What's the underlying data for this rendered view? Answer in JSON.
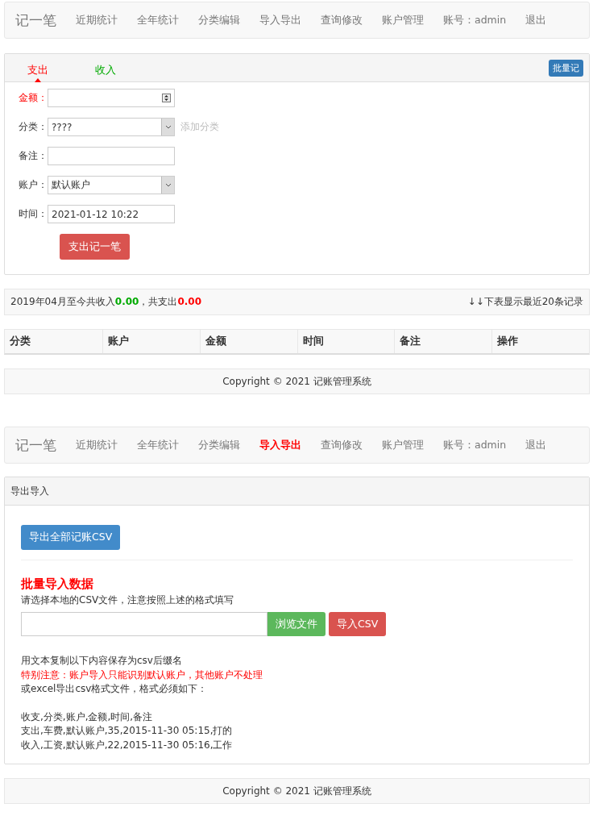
{
  "entry_screen": {
    "nav": {
      "brand": "记一笔",
      "items": [
        {
          "label": "近期统计",
          "selected": false
        },
        {
          "label": "全年统计",
          "selected": false
        },
        {
          "label": "分类编辑",
          "selected": false
        },
        {
          "label": "导入导出",
          "selected": false
        },
        {
          "label": "查询修改",
          "selected": false
        },
        {
          "label": "账户管理",
          "selected": false
        },
        {
          "label": "账号：admin",
          "selected": false
        },
        {
          "label": "退出",
          "selected": false
        }
      ]
    },
    "tabs": [
      {
        "label": "支出",
        "selected": true,
        "kind": "expense"
      },
      {
        "label": "收入",
        "selected": false,
        "kind": "income"
      }
    ],
    "batch_button": "批量记",
    "fields": [
      {
        "kind": "number",
        "label": "金额：",
        "required": true
      },
      {
        "kind": "select",
        "label": "分类：",
        "required": false,
        "value": "????",
        "link": "添加分类"
      },
      {
        "kind": "text",
        "label": "备注：",
        "required": false
      },
      {
        "kind": "select",
        "label": "账户：",
        "required": false,
        "value": "默认账户"
      },
      {
        "kind": "text",
        "label": "时间：",
        "required": false,
        "value": "2021-01-12 10:22"
      }
    ],
    "submit_button": "支出记一笔",
    "summary": {
      "prefix": "2019年04月至今共收入",
      "income": "0.00",
      "middle": "，共支出",
      "expense": "0.00",
      "note": "↓↓下表显示最近20条记录"
    },
    "table": {
      "columns": [
        "分类",
        "账户",
        "金额",
        "时间",
        "备注",
        "操作"
      ]
    },
    "footer": "Copyright © 2021 记账管理系统"
  },
  "import_screen": {
    "nav": {
      "brand": "记一笔",
      "items": [
        {
          "label": "近期统计",
          "selected": false
        },
        {
          "label": "全年统计",
          "selected": false
        },
        {
          "label": "分类编辑",
          "selected": false
        },
        {
          "label": "导入导出",
          "selected": true
        },
        {
          "label": "查询修改",
          "selected": false
        },
        {
          "label": "账户管理",
          "selected": false
        },
        {
          "label": "账号：admin",
          "selected": false
        },
        {
          "label": "退出",
          "selected": false
        }
      ]
    },
    "panel_title": "导出导入",
    "export_button": "导出全部记账CSV",
    "heading": "批量导入数据",
    "hint": "请选择本地的CSV文件，注意按照上述的格式填写",
    "browse_button": "浏览文件",
    "import_button": "导入CSV",
    "notes": [
      {
        "kind": "normal",
        "text": "用文本复制以下内容保存为csv后缀名"
      },
      {
        "kind": "warning",
        "text": "特别注意：账户导入只能识别默认账户，其他账户不处理"
      },
      {
        "kind": "normal",
        "text": "或excel导出csv格式文件，格式必须如下："
      }
    ],
    "format_lines": [
      "收支,分类,账户,金额,时间,备注",
      "支出,车费,默认账户,35,2015-11-30 05:15,打的",
      "收入,工资,默认账户,22,2015-11-30 05:16,工作"
    ],
    "footer": "Copyright © 2021 记账管理系统"
  }
}
